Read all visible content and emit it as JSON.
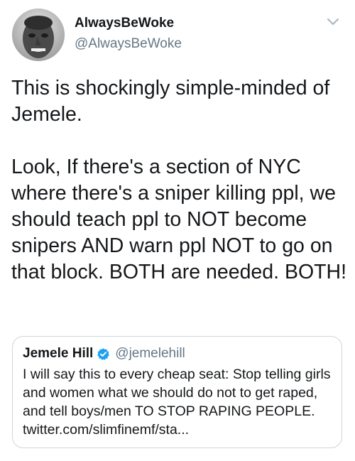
{
  "author": {
    "display_name": "AlwaysBeWoke",
    "handle": "@AlwaysBeWoke",
    "avatar_icon": "profile-photo"
  },
  "tweet": {
    "text": "This is shockingly simple-minded of Jemele.\n\nLook, If there's a section of NYC where there's a sniper killing ppl, we should teach ppl to NOT become snipers AND warn ppl NOT to go on that block. BOTH are needed. BOTH!"
  },
  "quoted_tweet": {
    "display_name": "Jemele Hill",
    "verified_icon": "verified-badge-icon",
    "handle": "@jemelehill",
    "text": "I will say this to every cheap seat: Stop telling girls and women what we should do not to get raped, and tell boys/men TO STOP RAPING PEOPLE. twitter.com/slimfinemf/sta..."
  },
  "colors": {
    "primary_text": "#14171a",
    "secondary_text": "#657786",
    "verified_blue": "#1da1f2",
    "border": "#ccd6dd"
  }
}
